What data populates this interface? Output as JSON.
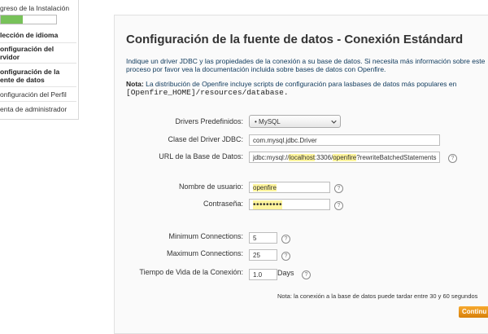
{
  "sidebar": {
    "title": "greso de la Instalación",
    "progress_fraction": 0.4,
    "items": [
      {
        "label": "lección de idioma",
        "active": true
      },
      {
        "label": "onfiguración del\nrvidor",
        "active": true
      },
      {
        "label": "onfiguración de la\nente de datos",
        "active": true
      },
      {
        "label": "onfiguración del Perfil",
        "active": false
      },
      {
        "label": "enta de administrador",
        "active": false
      }
    ]
  },
  "main": {
    "title": "Configuración de la fuente de datos - Conexión Estándard",
    "intro": "Indique un driver JDBC y las propiedades de la conexión a su base de datos. Si necesita más información sobre este proceso por favor vea la documentación incluida sobre bases de datos con Openfire.",
    "note_label": "Nota:",
    "note_text": "La distribución de Openfire incluye scripts de configuración para lasbases de datos más populares en",
    "note_path": "[Openfire_HOME]/resources/database.",
    "fields": {
      "drivers_label": "Drivers Predefinidos:",
      "drivers_selected": "• MySQL",
      "driver_class_label": "Clase del Driver JDBC:",
      "driver_class_value": "com.mysql.jdbc.Driver",
      "url_label": "URL de la Base de Datos:",
      "url_value_prefix": "jdbc:mysql://",
      "url_value_host": "localhost",
      "url_value_port": ":3306/",
      "url_value_db": "openfire",
      "url_value_suffix": "?rewriteBatchedStatements",
      "username_label": "Nombre de usuario:",
      "username_value": "openfire",
      "password_label": "Contraseña:",
      "password_value": "•••••••••",
      "min_conn_label": "Minimum Connections:",
      "min_conn_value": "5",
      "max_conn_label": "Maximum Connections:",
      "max_conn_value": "25",
      "lifetime_label": "Tiempo de Vida de la Conexión:",
      "lifetime_value": "1.0",
      "days_label": "Days"
    },
    "footer_note": "Nota: la conexión a la base de datos puede tardar entre 30 y 60 segundos",
    "continue_label": "Continu",
    "help_glyph": "?"
  },
  "colors": {
    "progress": "#78c25a",
    "highlight": "#fff59d",
    "intro_text": "#0f3a5d",
    "continue_button": "#e8920f"
  }
}
